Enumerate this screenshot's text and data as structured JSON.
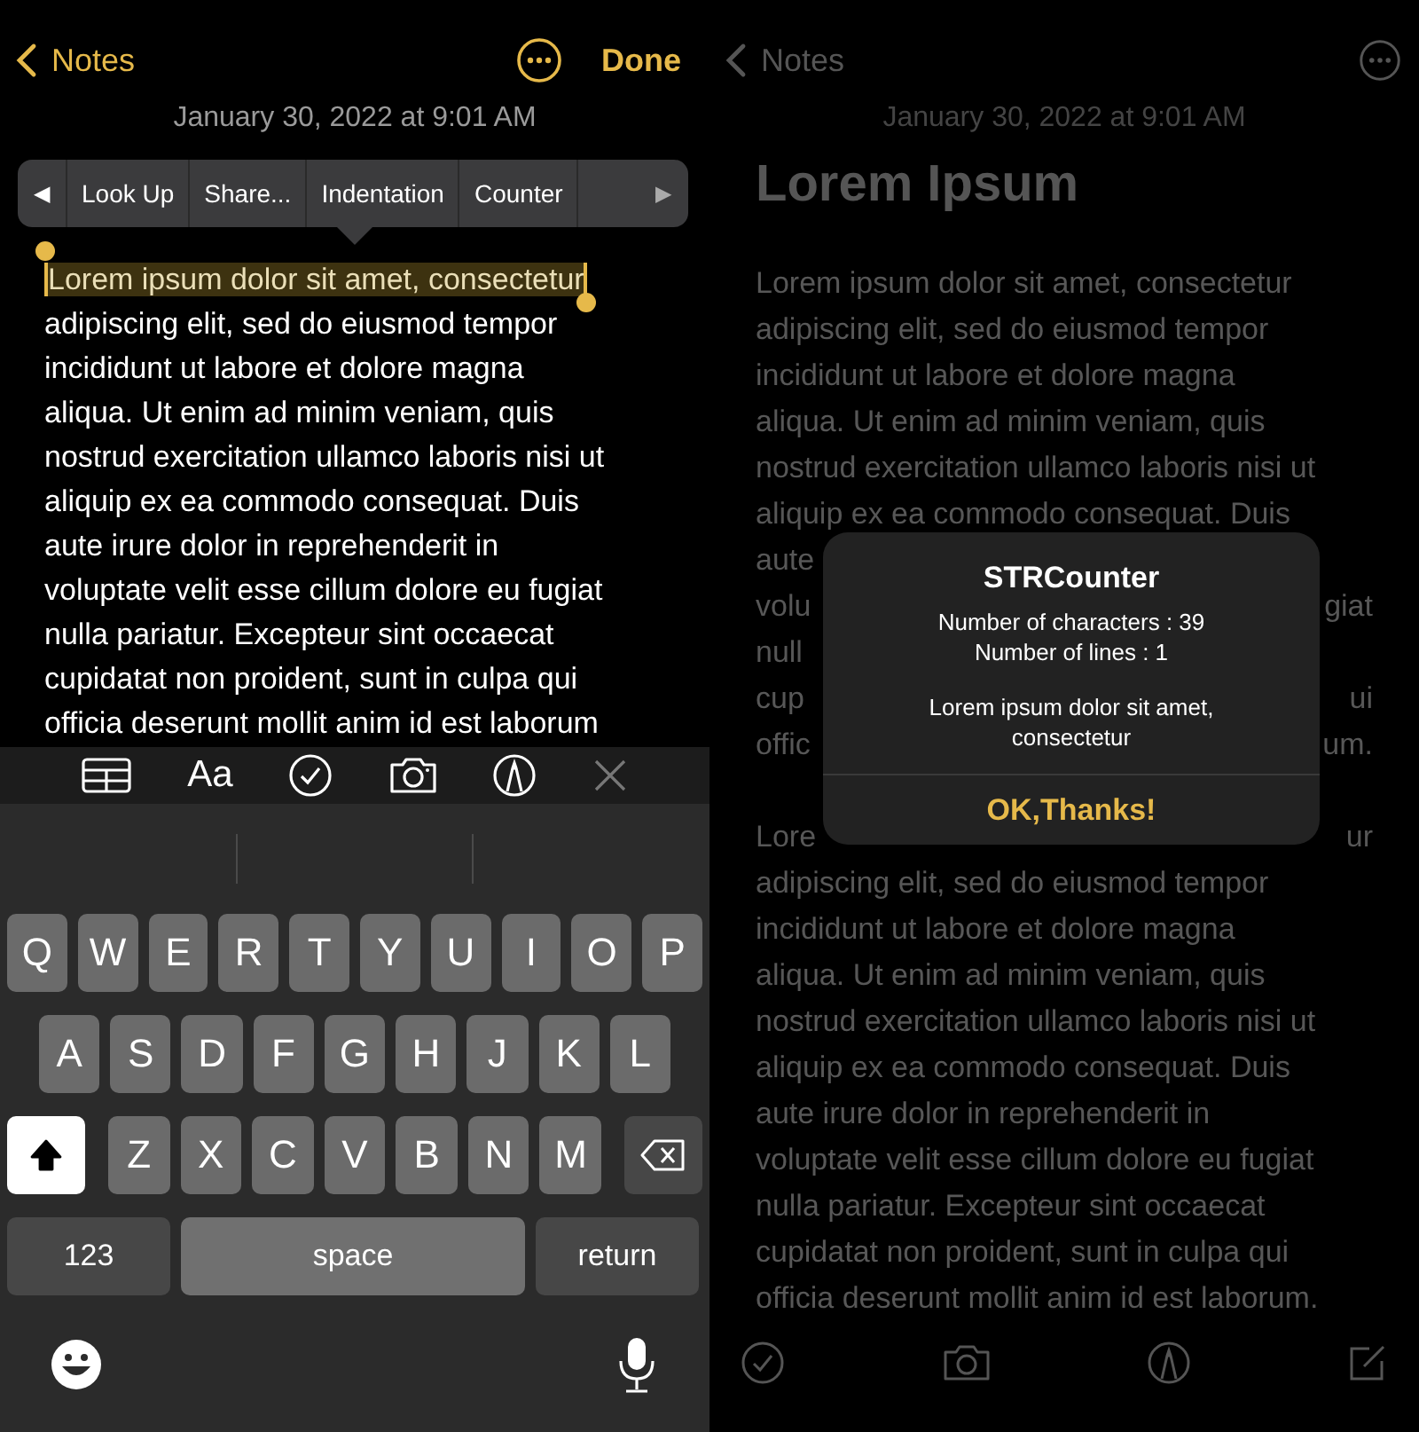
{
  "editor": {
    "nav": {
      "back": "Notes",
      "done": "Done"
    },
    "date": "January 30, 2022 at 9:01 AM",
    "context_menu": {
      "prev": "◀",
      "items": [
        "Look Up",
        "Share...",
        "Indentation",
        "Counter"
      ],
      "next": "▶"
    },
    "lines": [
      {
        "text": "Lorem ipsum dolor sit amet, consectetur",
        "selected": true
      },
      {
        "text": "adipiscing elit, sed do eiusmod tempor",
        "selected": false
      },
      {
        "text": "incididunt ut labore et dolore magna",
        "selected": false
      },
      {
        "text": "aliqua. Ut enim ad minim veniam, quis",
        "selected": false
      },
      {
        "text": "nostrud exercitation ullamco laboris nisi ut",
        "selected": false
      },
      {
        "text": "aliquip ex ea commodo consequat. Duis",
        "selected": false
      },
      {
        "text": "aute irure dolor in reprehenderit in",
        "selected": false
      },
      {
        "text": "voluptate velit esse cillum dolore eu fugiat",
        "selected": false
      },
      {
        "text": "nulla pariatur. Excepteur sint occaecat",
        "selected": false
      },
      {
        "text": "cupidatat non proident, sunt in culpa qui",
        "selected": false
      },
      {
        "text": "officia deserunt mollit anim id est laborum",
        "selected": false
      }
    ],
    "format_bar": {
      "text_style": "Aa"
    },
    "keyboard": {
      "rows": [
        [
          "Q",
          "W",
          "E",
          "R",
          "T",
          "Y",
          "U",
          "I",
          "O",
          "P"
        ],
        [
          "A",
          "S",
          "D",
          "F",
          "G",
          "H",
          "J",
          "K",
          "L"
        ],
        [
          "Z",
          "X",
          "C",
          "V",
          "B",
          "N",
          "M"
        ]
      ],
      "shift_on": true,
      "numbers": "123",
      "space": "space",
      "return": "return"
    }
  },
  "viewer": {
    "nav": {
      "back": "Notes"
    },
    "date": "January 30, 2022 at 9:01 AM",
    "title": "Lorem Ipsum",
    "paragraphs": [
      [
        {
          "kind": "full",
          "text": "Lorem ipsum dolor sit amet, consectetur"
        },
        {
          "kind": "full",
          "text": "adipiscing elit, sed do eiusmod tempor"
        },
        {
          "kind": "full",
          "text": "incididunt ut labore et dolore magna"
        },
        {
          "kind": "full",
          "text": "aliqua. Ut enim ad minim veniam, quis"
        },
        {
          "kind": "full",
          "text": "nostrud exercitation ullamco laboris nisi ut"
        },
        {
          "kind": "full",
          "text": "aliquip ex ea commodo consequat. Duis"
        },
        {
          "kind": "split",
          "left": "aute"
        },
        {
          "kind": "split",
          "left": "volu",
          "right": "giat"
        },
        {
          "kind": "split",
          "left": "null"
        },
        {
          "kind": "split",
          "left": "cup",
          "right": "ui"
        },
        {
          "kind": "split",
          "left": "offic",
          "right": "um."
        }
      ],
      [
        {
          "kind": "split",
          "left": "Lore",
          "right": "ur"
        },
        {
          "kind": "full",
          "text": "adipiscing elit, sed do eiusmod tempor"
        },
        {
          "kind": "full",
          "text": "incididunt ut labore et dolore magna"
        },
        {
          "kind": "full",
          "text": "aliqua. Ut enim ad minim veniam, quis"
        },
        {
          "kind": "full",
          "text": "nostrud exercitation ullamco laboris nisi ut"
        },
        {
          "kind": "full",
          "text": "aliquip ex ea commodo consequat. Duis"
        },
        {
          "kind": "full",
          "text": "aute irure dolor in reprehenderit in"
        },
        {
          "kind": "full",
          "text": "voluptate velit esse cillum dolore eu fugiat"
        },
        {
          "kind": "full",
          "text": "nulla pariatur. Excepteur sint occaecat"
        },
        {
          "kind": "full",
          "text": "cupidatat non proident, sunt in culpa qui"
        },
        {
          "kind": "full",
          "text": "officia deserunt mollit anim id est laborum."
        }
      ]
    ],
    "alert": {
      "title": "STRCounter",
      "stats": [
        "Number of characters : 39",
        "Number of lines : 1"
      ],
      "message": "Lorem ipsum dolor sit amet, consectetur",
      "button": "OK,Thanks!"
    }
  }
}
